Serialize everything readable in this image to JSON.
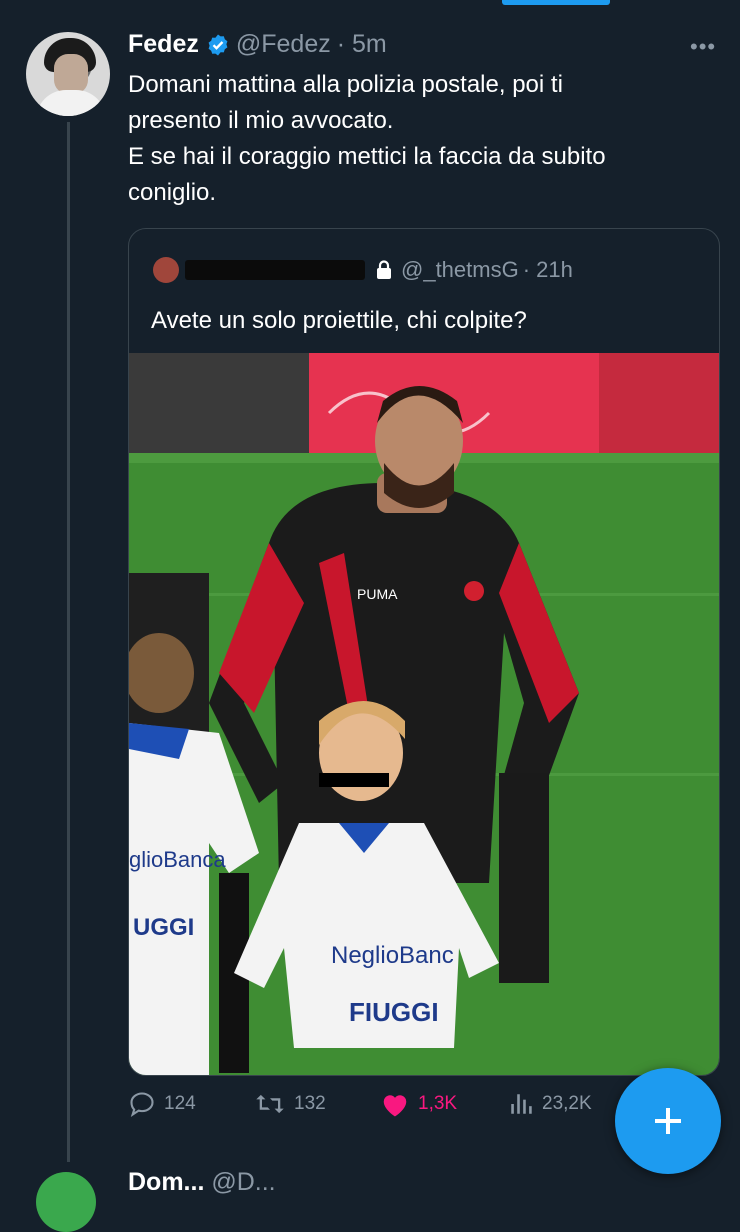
{
  "tweet": {
    "author_name": "Fedez",
    "handle": "@Fedez",
    "time": "· 5m",
    "more": "•••",
    "lines": [
      "Domani mattina alla polizia postale, poi ti",
      "presento il mio avvocato.",
      "E se hai il coraggio mettici la faccia da subito",
      "coniglio."
    ]
  },
  "quote": {
    "handle": "@_thetmsG",
    "time": "· 21h",
    "text": "Avete un solo proiettile, chi colpite?",
    "photo_texts": {
      "sponsor_left": "glioBanca",
      "brand_left": "UGGI",
      "sponsor_child": "NeglioBanc",
      "brand_child": "FIUGGI"
    }
  },
  "actions": {
    "replies": "124",
    "retweets": "132",
    "likes": "1,3K",
    "views": "23,2K"
  },
  "next_tweet": {
    "name": "Dom...",
    "handle": "@D..."
  },
  "colors": {
    "background": "#15202b",
    "accent": "#1d9bf0",
    "like": "#f91880",
    "muted": "#8b98a5",
    "border": "#38444d"
  }
}
